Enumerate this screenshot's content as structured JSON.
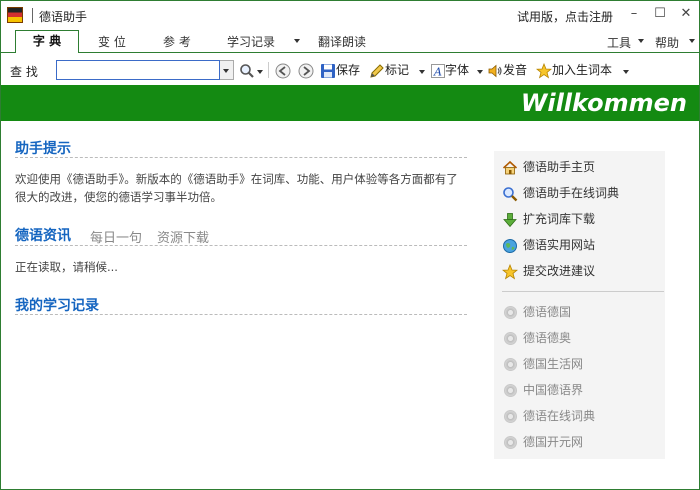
{
  "window": {
    "title": "德语助手",
    "trial_text": "试用版，点击注册",
    "minimize": "–",
    "maximize": "☐",
    "close": "✕"
  },
  "tabs": [
    {
      "label": "字  典",
      "active": true
    },
    {
      "label": "变  位",
      "active": false
    },
    {
      "label": "参  考",
      "active": false
    },
    {
      "label": "学习记录",
      "active": false
    },
    {
      "label": "翻译朗读",
      "active": false
    }
  ],
  "menus": {
    "tools": "工具",
    "help": "帮助"
  },
  "toolbar": {
    "search_label": "查  找",
    "search_value": "",
    "save": "保存",
    "mark": "标记",
    "font": "字体",
    "pronounce": "发音",
    "add_wordbook": "加入生词本"
  },
  "banner": {
    "text": "Willkommen"
  },
  "sections": {
    "assistant_tips": {
      "title": "助手提示",
      "text": "欢迎使用《德语助手》。新版本的《德语助手》在词库、功能、用户体验等各方面都有了很大的改进，使您的德语学习事半功倍。"
    },
    "news": {
      "title": "德语资讯",
      "tab_daily": "每日一句",
      "tab_downloads": "资源下载",
      "status": "正在读取，请稍候..."
    },
    "records": {
      "title": "我的学习记录"
    }
  },
  "links": [
    {
      "label": "德语助手主页",
      "icon": "home-icon"
    },
    {
      "label": "德语助手在线词典",
      "icon": "magnifier-icon"
    },
    {
      "label": "扩充词库下载",
      "icon": "download-arrow-icon"
    },
    {
      "label": "德语实用网站",
      "icon": "globe-icon"
    },
    {
      "label": "提交改进建议",
      "icon": "star-icon"
    }
  ],
  "sites": [
    {
      "label": "德语德国"
    },
    {
      "label": "德语德奥"
    },
    {
      "label": "德国生活网"
    },
    {
      "label": "中国德语界"
    },
    {
      "label": "德语在线词典"
    },
    {
      "label": "德国开元网"
    }
  ],
  "colors": {
    "brand_green": "#148a12",
    "link_blue": "#1565c0"
  }
}
